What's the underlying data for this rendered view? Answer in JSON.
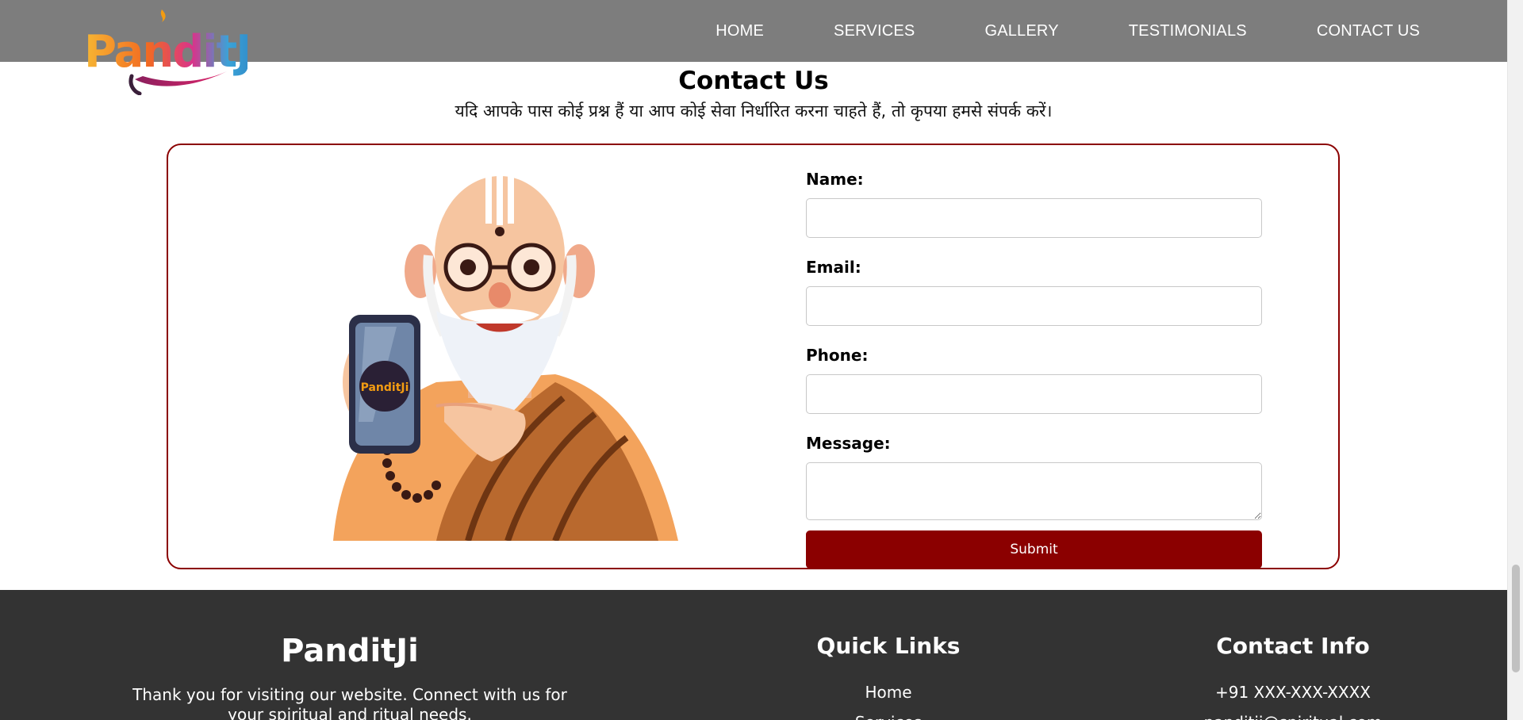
{
  "header": {
    "logo_text": "PanditJi",
    "nav": [
      {
        "label": "HOME"
      },
      {
        "label": "SERVICES"
      },
      {
        "label": "GALLERY"
      },
      {
        "label": "TESTIMONIALS"
      },
      {
        "label": "CONTACT US"
      }
    ]
  },
  "contact": {
    "title": "Contact Us",
    "subtitle": "यदि आपके पास कोई प्रश्न हैं या आप कोई सेवा निर्धारित करना चाहते हैं, तो कृपया हमसे संपर्क करें।",
    "phone_logo_text": "PanditJi",
    "form": {
      "name_label": "Name:",
      "name_value": "",
      "email_label": "Email:",
      "email_value": "",
      "phone_label": "Phone:",
      "phone_value": "",
      "message_label": "Message:",
      "message_value": "",
      "submit_label": "Submit"
    }
  },
  "footer": {
    "brand": "PanditJi",
    "description": "Thank you for visiting our website. Connect with us for your spiritual and ritual needs.",
    "quick_links_title": "Quick Links",
    "quick_links": [
      {
        "label": "Home"
      },
      {
        "label": "Services"
      }
    ],
    "contact_info_title": "Contact Info",
    "contact_info": [
      {
        "label": "+91 XXX-XXX-XXXX"
      },
      {
        "label": "panditji@spiritual.com"
      }
    ]
  },
  "colors": {
    "header_bg": "#7d7d7d",
    "accent": "#8b0000",
    "footer_bg": "#333333"
  }
}
